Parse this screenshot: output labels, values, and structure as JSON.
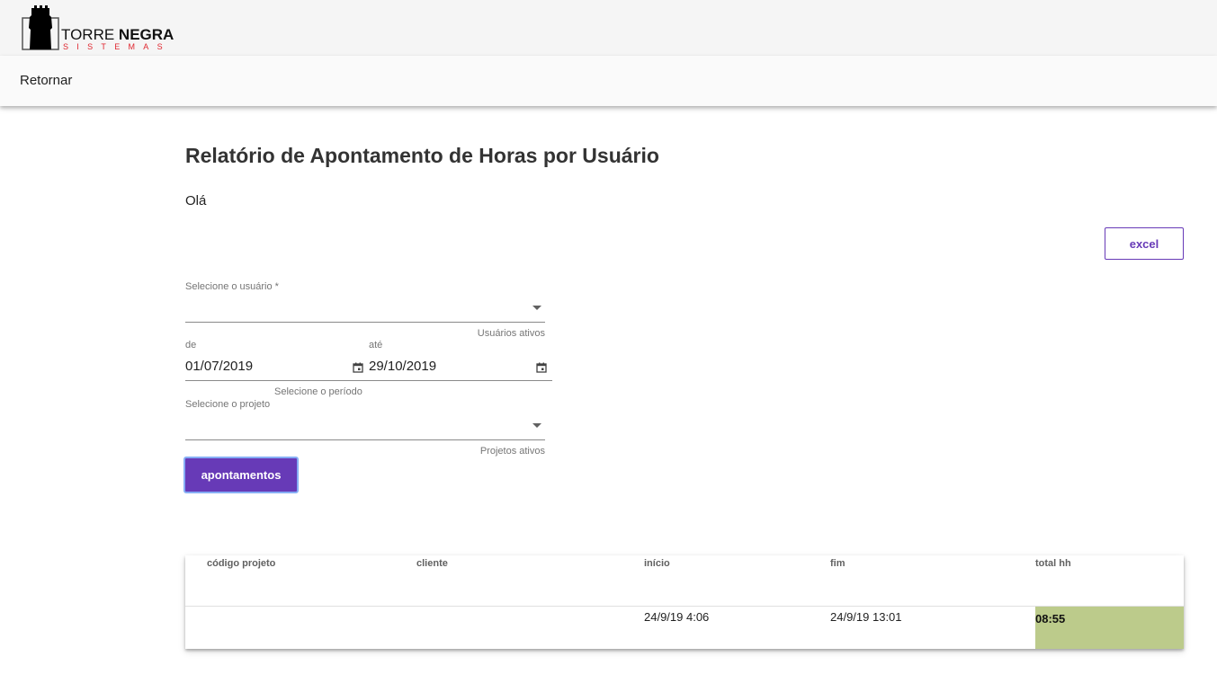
{
  "brand": {
    "name_part1": "TORRE ",
    "name_part2": "NEGRA",
    "tagline": "SISTEMAS",
    "tagline_color": "#e0262f"
  },
  "nav": {
    "back_label": "Retornar"
  },
  "page": {
    "title": "Relatório de Apontamento de Horas por Usuário",
    "greeting": "Olá"
  },
  "toolbar": {
    "excel_label": "excel"
  },
  "form": {
    "user_select": {
      "label": "Selecione o usuário *",
      "value": "",
      "hint": "Usuários ativos"
    },
    "date_from": {
      "label": "de",
      "value": "01/07/2019"
    },
    "date_to": {
      "label": "até",
      "value": "29/10/2019"
    },
    "period_hint": "Selecione o período",
    "project_select": {
      "label": "Selecione o projeto",
      "value": "",
      "hint": "Projetos ativos"
    },
    "submit_label": "apontamentos"
  },
  "table": {
    "columns": [
      "código projeto",
      "cliente",
      "início",
      "fim",
      "total hh"
    ],
    "rows": [
      {
        "codigo_projeto": "",
        "cliente": "",
        "inicio": "24/9/19 4:06",
        "fim": "24/9/19 13:01",
        "total_hh": "08:55"
      }
    ]
  },
  "colors": {
    "accent": "#673ab7",
    "total_highlight": "#bccb8b",
    "focus_ring": "#86aef5"
  }
}
